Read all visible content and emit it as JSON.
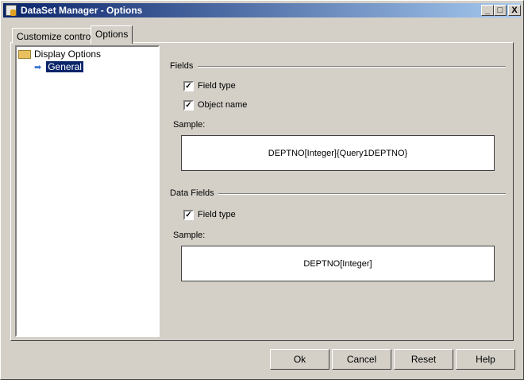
{
  "window": {
    "title": "DataSet Manager - Options"
  },
  "tabs": [
    "Customize controls",
    "Options"
  ],
  "tree": {
    "root": "Display Options",
    "child": "General"
  },
  "fields": {
    "heading": "Fields",
    "field_type": "Field type",
    "object_name": "Object name",
    "sample_label": "Sample:",
    "sample": "DEPTNO[Integer]{Query1DEPTNO}",
    "field_type_checked": true,
    "object_name_checked": true
  },
  "data_fields": {
    "heading": "Data Fields",
    "field_type": "Field type",
    "sample_label": "Sample:",
    "sample": "DEPTNO[Integer]",
    "field_type_checked": true
  },
  "buttons": {
    "ok": "Ok",
    "cancel": "Cancel",
    "reset": "Reset",
    "help": "Help"
  },
  "title_buttons": {
    "minimize": "_",
    "maximize": "□",
    "close": "X"
  }
}
